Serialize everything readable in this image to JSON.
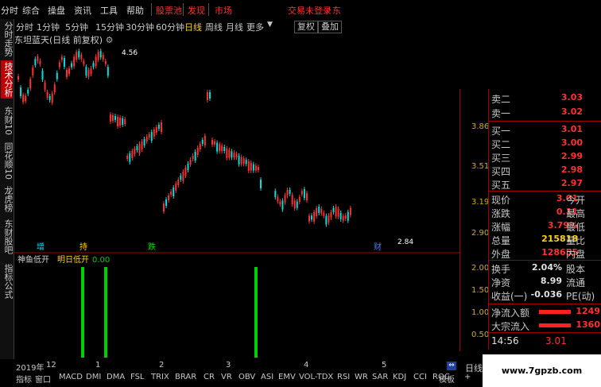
{
  "menu": {
    "items": [
      "分时",
      "综合",
      "操盘",
      "资讯",
      "工具",
      "帮助"
    ],
    "red_items": [
      "股票池",
      "发现",
      "市场"
    ],
    "login": "交易未登录",
    "extra": "东"
  },
  "left_tabs": [
    "分时走势",
    "技术分析",
    "东财10",
    "同花顺10",
    "龙虎榜",
    "东财股吧"
  ],
  "periods": [
    "分时",
    "1分钟",
    "5分钟",
    "15分钟",
    "30分钟",
    "60分钟",
    "日线",
    "周线",
    "月线",
    "更多"
  ],
  "buttons": {
    "restore": "复权",
    "overlay": "叠加"
  },
  "stock_title": "东坦蓝天(日线 前复权)",
  "chart_annotations": {
    "high": "4.56",
    "low": "2.84"
  },
  "event_markers": [
    "增",
    "持",
    "跌",
    "财"
  ],
  "price_axis": [
    "3.86",
    "3.51",
    "3.19",
    "2.90"
  ],
  "indicator": {
    "name": "神鱼低开",
    "label": "明日低开",
    "value": "0.00"
  },
  "indicator_axis": [
    "2.00",
    "1.50",
    "1.00",
    "0.50"
  ],
  "formula_tab": "指标公式",
  "quote": {
    "asks": [
      {
        "label": "卖二",
        "value": "3.03"
      },
      {
        "label": "卖一",
        "value": "3.02"
      }
    ],
    "bids": [
      {
        "label": "买一",
        "value": "3.01"
      },
      {
        "label": "买二",
        "value": "3.00"
      },
      {
        "label": "买三",
        "value": "2.99"
      },
      {
        "label": "买四",
        "value": "2.98"
      },
      {
        "label": "买五",
        "value": "2.97"
      }
    ],
    "stats": [
      {
        "label": "现价",
        "value": "3.01",
        "label2": "今开"
      },
      {
        "label": "涨跌",
        "value": "0.11",
        "label2": "最高"
      },
      {
        "label": "涨幅",
        "value": "3.79%",
        "label2": "最低"
      },
      {
        "label": "总量",
        "value": "215818",
        "label2": "量比"
      },
      {
        "label": "外盘",
        "value": "128655",
        "label2": "内盘"
      },
      {
        "label": "换手",
        "value": "2.04%",
        "label2": "股本"
      },
      {
        "label": "净资",
        "value": "8.99",
        "label2": "流通"
      },
      {
        "label": "收益(一)",
        "value": "-0.036",
        "label2": "PE(动)"
      }
    ],
    "flows": [
      {
        "label": "净流入额",
        "value": "1249"
      },
      {
        "label": "大宗流入",
        "value": "1360"
      }
    ],
    "time": "14:56",
    "last": "3.01"
  },
  "timeline": [
    "2019年",
    "12",
    "1",
    "2",
    "3",
    "4",
    "5"
  ],
  "bottom_tabs": [
    "指标",
    "窗口",
    "MACD",
    "DMI",
    "DMA",
    "FSL",
    "TRIX",
    "BRAR",
    "CR",
    "VR",
    "OBV",
    "ASI",
    "EMV",
    "VOL-TDX",
    "RSI",
    "WR",
    "SAR",
    "KDJ",
    "CCI",
    "ROC"
  ],
  "bottom_right": [
    "模板",
    "+"
  ],
  "day_label": "日线",
  "watermark": "www.7gpzb.com",
  "colors": {
    "up": "#ff3030",
    "down": "#00e0e0",
    "signal": "#00d000",
    "accent": "#ffd200",
    "axis": "#a00000"
  }
}
